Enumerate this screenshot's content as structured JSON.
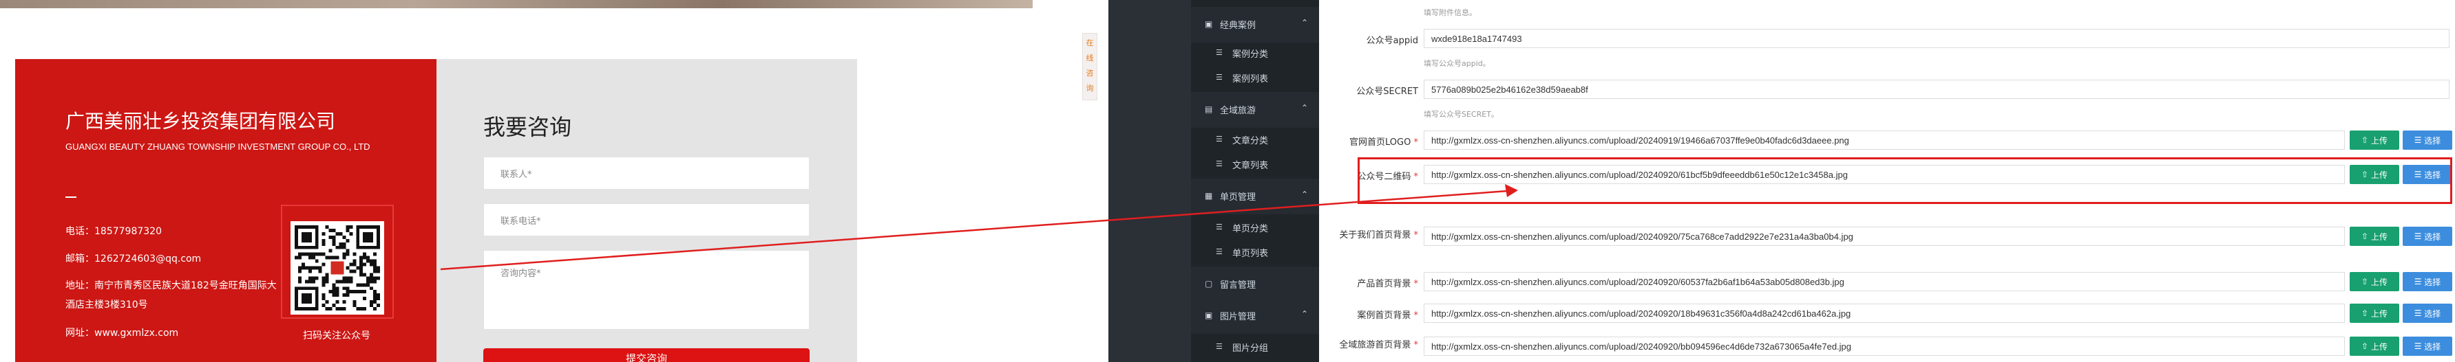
{
  "website": {
    "company_name": "广西美丽壮乡投资集团有限公司",
    "company_en": "GUANGXI BEAUTY ZHUANG TOWNSHIP INVESTMENT GROUP CO., LTD",
    "divider": "—",
    "phone": "电话：18577987320",
    "email": "邮箱：1262724603@qq.com",
    "address": "地址：南宁市青秀区民族大道182号金旺角国际大酒店主楼3楼310号",
    "website": "网址：www.gxmlzx.com",
    "qr_caption": "扫码关注公众号",
    "form": {
      "title": "我要咨询",
      "contact_placeholder": "联系人*",
      "phone_placeholder": "联系电话*",
      "content_placeholder": "咨询内容*",
      "submit_label": "提交咨询"
    },
    "side_float_text": "在线咨询"
  },
  "admin": {
    "menu": [
      {
        "label": "经典案例",
        "children": [
          "案例分类",
          "案例列表"
        ]
      },
      {
        "label": "全域旅游",
        "children": [
          "文章分类",
          "文章列表"
        ]
      },
      {
        "label": "单页管理",
        "children": [
          "单页分类",
          "单页列表"
        ]
      },
      {
        "label": "留言管理",
        "children": []
      },
      {
        "label": "图片管理",
        "children": [
          "图片分组"
        ]
      }
    ],
    "fields": [
      {
        "hint": "填写附件信息。"
      },
      {
        "label": "公众号appid",
        "value": "wxde918e18a1747493",
        "hint": "填写公众号appid。"
      },
      {
        "label": "公众号SECRET",
        "value": "5776a089b025e2b46162e38d59aeab8f",
        "hint": "填写公众号SECRET。"
      },
      {
        "label": "官网首页LOGO",
        "value": "http://gxmlzx.oss-cn-shenzhen.aliyuncs.com/upload/20240919/19466a67037ffe9e0b40fadc6d3daeee.png"
      },
      {
        "label": "公众号二维码",
        "value": "http://gxmlzx.oss-cn-shenzhen.aliyuncs.com/upload/20240920/61bcf5b9dfeeeddb61e50c12e1c3458a.jpg"
      },
      {
        "label": "关于我们首页背景",
        "value": "http://gxmlzx.oss-cn-shenzhen.aliyuncs.com/upload/20240920/75ca768ce7add2922e7e231a4a3ba0b4.jpg"
      },
      {
        "label": "产品首页背景",
        "value": "http://gxmlzx.oss-cn-shenzhen.aliyuncs.com/upload/20240920/60537fa2b6af1b64a53ab05d808ed3b.jpg"
      },
      {
        "label": "案例首页背景",
        "value": "http://gxmlzx.oss-cn-shenzhen.aliyuncs.com/upload/20240920/18b49631c356f0a4d8a242cd61ba462a.jpg"
      },
      {
        "label": "全域旅游首页背景",
        "value": "http://gxmlzx.oss-cn-shenzhen.aliyuncs.com/upload/20240920/bb094596ec4d6de732a673065a4fe7ed.jpg"
      }
    ],
    "upload_label": "上传",
    "select_label": "选择"
  },
  "colors": {
    "brand_red": "#cc1714",
    "admin_sidebar": "#1f2429",
    "upload_green": "#18a070",
    "select_blue": "#3c8dde",
    "annotation_red": "#e01e1e"
  }
}
